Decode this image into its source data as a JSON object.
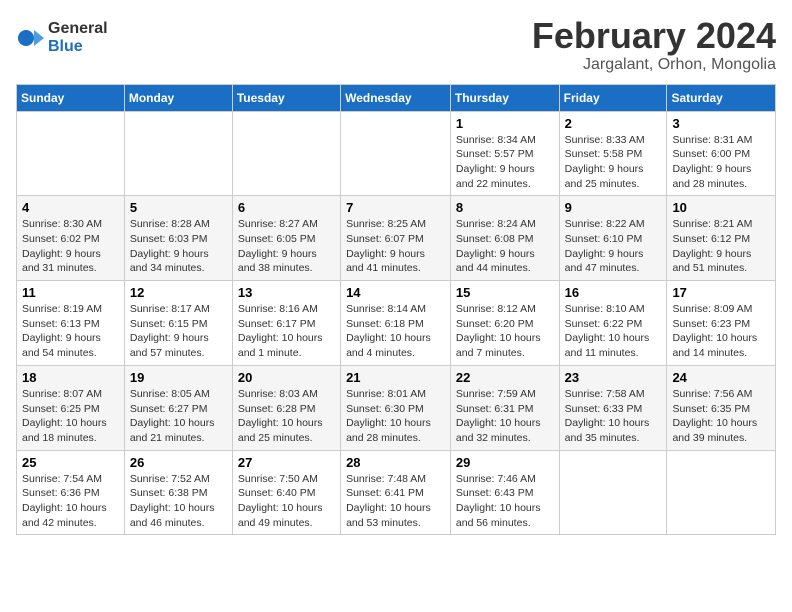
{
  "header": {
    "logo": {
      "general": "General",
      "blue": "Blue"
    },
    "title": "February 2024",
    "location": "Jargalant, Orhon, Mongolia"
  },
  "calendar": {
    "days_of_week": [
      "Sunday",
      "Monday",
      "Tuesday",
      "Wednesday",
      "Thursday",
      "Friday",
      "Saturday"
    ],
    "weeks": [
      [
        {
          "day": "",
          "info": ""
        },
        {
          "day": "",
          "info": ""
        },
        {
          "day": "",
          "info": ""
        },
        {
          "day": "",
          "info": ""
        },
        {
          "day": "1",
          "info": "Sunrise: 8:34 AM\nSunset: 5:57 PM\nDaylight: 9 hours and 22 minutes."
        },
        {
          "day": "2",
          "info": "Sunrise: 8:33 AM\nSunset: 5:58 PM\nDaylight: 9 hours and 25 minutes."
        },
        {
          "day": "3",
          "info": "Sunrise: 8:31 AM\nSunset: 6:00 PM\nDaylight: 9 hours and 28 minutes."
        }
      ],
      [
        {
          "day": "4",
          "info": "Sunrise: 8:30 AM\nSunset: 6:02 PM\nDaylight: 9 hours and 31 minutes."
        },
        {
          "day": "5",
          "info": "Sunrise: 8:28 AM\nSunset: 6:03 PM\nDaylight: 9 hours and 34 minutes."
        },
        {
          "day": "6",
          "info": "Sunrise: 8:27 AM\nSunset: 6:05 PM\nDaylight: 9 hours and 38 minutes."
        },
        {
          "day": "7",
          "info": "Sunrise: 8:25 AM\nSunset: 6:07 PM\nDaylight: 9 hours and 41 minutes."
        },
        {
          "day": "8",
          "info": "Sunrise: 8:24 AM\nSunset: 6:08 PM\nDaylight: 9 hours and 44 minutes."
        },
        {
          "day": "9",
          "info": "Sunrise: 8:22 AM\nSunset: 6:10 PM\nDaylight: 9 hours and 47 minutes."
        },
        {
          "day": "10",
          "info": "Sunrise: 8:21 AM\nSunset: 6:12 PM\nDaylight: 9 hours and 51 minutes."
        }
      ],
      [
        {
          "day": "11",
          "info": "Sunrise: 8:19 AM\nSunset: 6:13 PM\nDaylight: 9 hours and 54 minutes."
        },
        {
          "day": "12",
          "info": "Sunrise: 8:17 AM\nSunset: 6:15 PM\nDaylight: 9 hours and 57 minutes."
        },
        {
          "day": "13",
          "info": "Sunrise: 8:16 AM\nSunset: 6:17 PM\nDaylight: 10 hours and 1 minute."
        },
        {
          "day": "14",
          "info": "Sunrise: 8:14 AM\nSunset: 6:18 PM\nDaylight: 10 hours and 4 minutes."
        },
        {
          "day": "15",
          "info": "Sunrise: 8:12 AM\nSunset: 6:20 PM\nDaylight: 10 hours and 7 minutes."
        },
        {
          "day": "16",
          "info": "Sunrise: 8:10 AM\nSunset: 6:22 PM\nDaylight: 10 hours and 11 minutes."
        },
        {
          "day": "17",
          "info": "Sunrise: 8:09 AM\nSunset: 6:23 PM\nDaylight: 10 hours and 14 minutes."
        }
      ],
      [
        {
          "day": "18",
          "info": "Sunrise: 8:07 AM\nSunset: 6:25 PM\nDaylight: 10 hours and 18 minutes."
        },
        {
          "day": "19",
          "info": "Sunrise: 8:05 AM\nSunset: 6:27 PM\nDaylight: 10 hours and 21 minutes."
        },
        {
          "day": "20",
          "info": "Sunrise: 8:03 AM\nSunset: 6:28 PM\nDaylight: 10 hours and 25 minutes."
        },
        {
          "day": "21",
          "info": "Sunrise: 8:01 AM\nSunset: 6:30 PM\nDaylight: 10 hours and 28 minutes."
        },
        {
          "day": "22",
          "info": "Sunrise: 7:59 AM\nSunset: 6:31 PM\nDaylight: 10 hours and 32 minutes."
        },
        {
          "day": "23",
          "info": "Sunrise: 7:58 AM\nSunset: 6:33 PM\nDaylight: 10 hours and 35 minutes."
        },
        {
          "day": "24",
          "info": "Sunrise: 7:56 AM\nSunset: 6:35 PM\nDaylight: 10 hours and 39 minutes."
        }
      ],
      [
        {
          "day": "25",
          "info": "Sunrise: 7:54 AM\nSunset: 6:36 PM\nDaylight: 10 hours and 42 minutes."
        },
        {
          "day": "26",
          "info": "Sunrise: 7:52 AM\nSunset: 6:38 PM\nDaylight: 10 hours and 46 minutes."
        },
        {
          "day": "27",
          "info": "Sunrise: 7:50 AM\nSunset: 6:40 PM\nDaylight: 10 hours and 49 minutes."
        },
        {
          "day": "28",
          "info": "Sunrise: 7:48 AM\nSunset: 6:41 PM\nDaylight: 10 hours and 53 minutes."
        },
        {
          "day": "29",
          "info": "Sunrise: 7:46 AM\nSunset: 6:43 PM\nDaylight: 10 hours and 56 minutes."
        },
        {
          "day": "",
          "info": ""
        },
        {
          "day": "",
          "info": ""
        }
      ]
    ]
  }
}
